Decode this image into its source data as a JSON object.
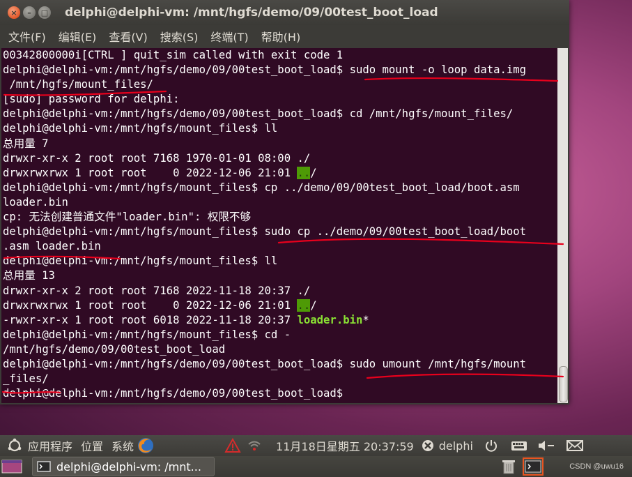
{
  "window": {
    "title": "delphi@delphi-vm: /mnt/hgfs/demo/09/00test_boot_load",
    "buttons": {
      "close": "×",
      "min": "–",
      "max": "□"
    }
  },
  "menubar": [
    "文件(F)",
    "编辑(E)",
    "查看(V)",
    "搜索(S)",
    "终端(T)",
    "帮助(H)"
  ],
  "terminal": {
    "background": "#300a24",
    "lines": [
      "00342800000i[CTRL ] quit_sim called with exit code 1",
      "delphi@delphi-vm:/mnt/hgfs/demo/09/00test_boot_load$ sudo mount -o loop data.img",
      " /mnt/hgfs/mount_files/",
      "[sudo] password for delphi:",
      "delphi@delphi-vm:/mnt/hgfs/demo/09/00test_boot_load$ cd /mnt/hgfs/mount_files/",
      "delphi@delphi-vm:/mnt/hgfs/mount_files$ ll",
      "总用量 7",
      "drwxr-xr-x 2 root root 7168 1970-01-01 08:00 ./",
      "drwxrwxrwx 1 root root    0 2022-12-06 21:01 ",
      "delphi@delphi-vm:/mnt/hgfs/mount_files$ cp ../demo/09/00test_boot_load/boot.asm",
      "loader.bin",
      "cp: 无法创建普通文件\"loader.bin\": 权限不够",
      "delphi@delphi-vm:/mnt/hgfs/mount_files$ sudo cp ../demo/09/00test_boot_load/boot",
      ".asm loader.bin",
      "delphi@delphi-vm:/mnt/hgfs/mount_files$ ll",
      "总用量 13",
      "drwxr-xr-x 2 root root 7168 2022-11-18 20:37 ./",
      "drwxrwxrwx 1 root root    0 2022-12-06 21:01 ",
      "-rwxr-xr-x 1 root root 6018 2022-11-18 20:37 ",
      "delphi@delphi-vm:/mnt/hgfs/mount_files$ cd -",
      "/mnt/hgfs/demo/09/00test_boot_load",
      "delphi@delphi-vm:/mnt/hgfs/demo/09/00test_boot_load$ sudo umount /mnt/hgfs/mount",
      "_files/",
      "delphi@delphi-vm:/mnt/hgfs/demo/09/00test_boot_load$ "
    ],
    "parent_dir": "..",
    "dir_suffix": "/",
    "exe_name": "loader.bin",
    "exe_suffix": "*",
    "cursor": " "
  },
  "panel_top": {
    "apps": "应用程序",
    "places": "位置",
    "system": "系统",
    "datetime": "11月18日星期五 20:37:59",
    "user": "delphi"
  },
  "panel_bottom": {
    "task_label": "delphi@delphi-vm: /mnt..."
  },
  "watermark": "CSDN @uwu16",
  "colors": {
    "annotation": "#e8001c",
    "exe": "#8ae234",
    "dir_bg": "#4e9a06"
  }
}
